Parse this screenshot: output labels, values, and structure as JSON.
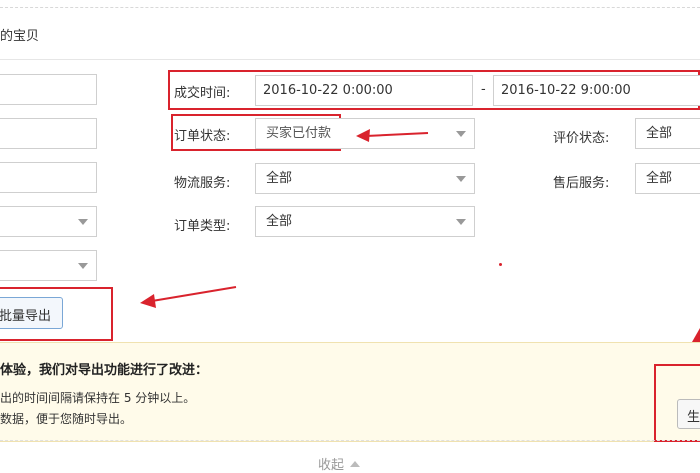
{
  "header": {
    "section_title": "的宝贝"
  },
  "filters": {
    "deal_time": {
      "label": "成交时间:",
      "start": "2016-10-22 0:00:00",
      "separator": "-",
      "end": "2016-10-22 9:00:00"
    },
    "order_status": {
      "label": "订单状态:",
      "value": "买家已付款"
    },
    "review_status": {
      "label": "评价状态:",
      "value": "全部"
    },
    "logistics": {
      "label": "物流服务:",
      "value": "全部"
    },
    "after_sale": {
      "label": "售后服务:",
      "value": "全部"
    },
    "order_type": {
      "label": "订单类型:",
      "value": "全部"
    }
  },
  "buttons": {
    "batch_export": "批量导出",
    "generate": "生"
  },
  "notice": {
    "title": "体验，我们对导出功能进行了改进：",
    "line1": "出的时间间隔请保持在 5 分钟以上。",
    "line2": "数据，便于您随时导出。"
  },
  "footer": {
    "collapse_label": "收起"
  },
  "colors": {
    "annotation_red": "#d9232d",
    "notice_bg": "#fffbea",
    "button_border": "#7aa7d6"
  }
}
